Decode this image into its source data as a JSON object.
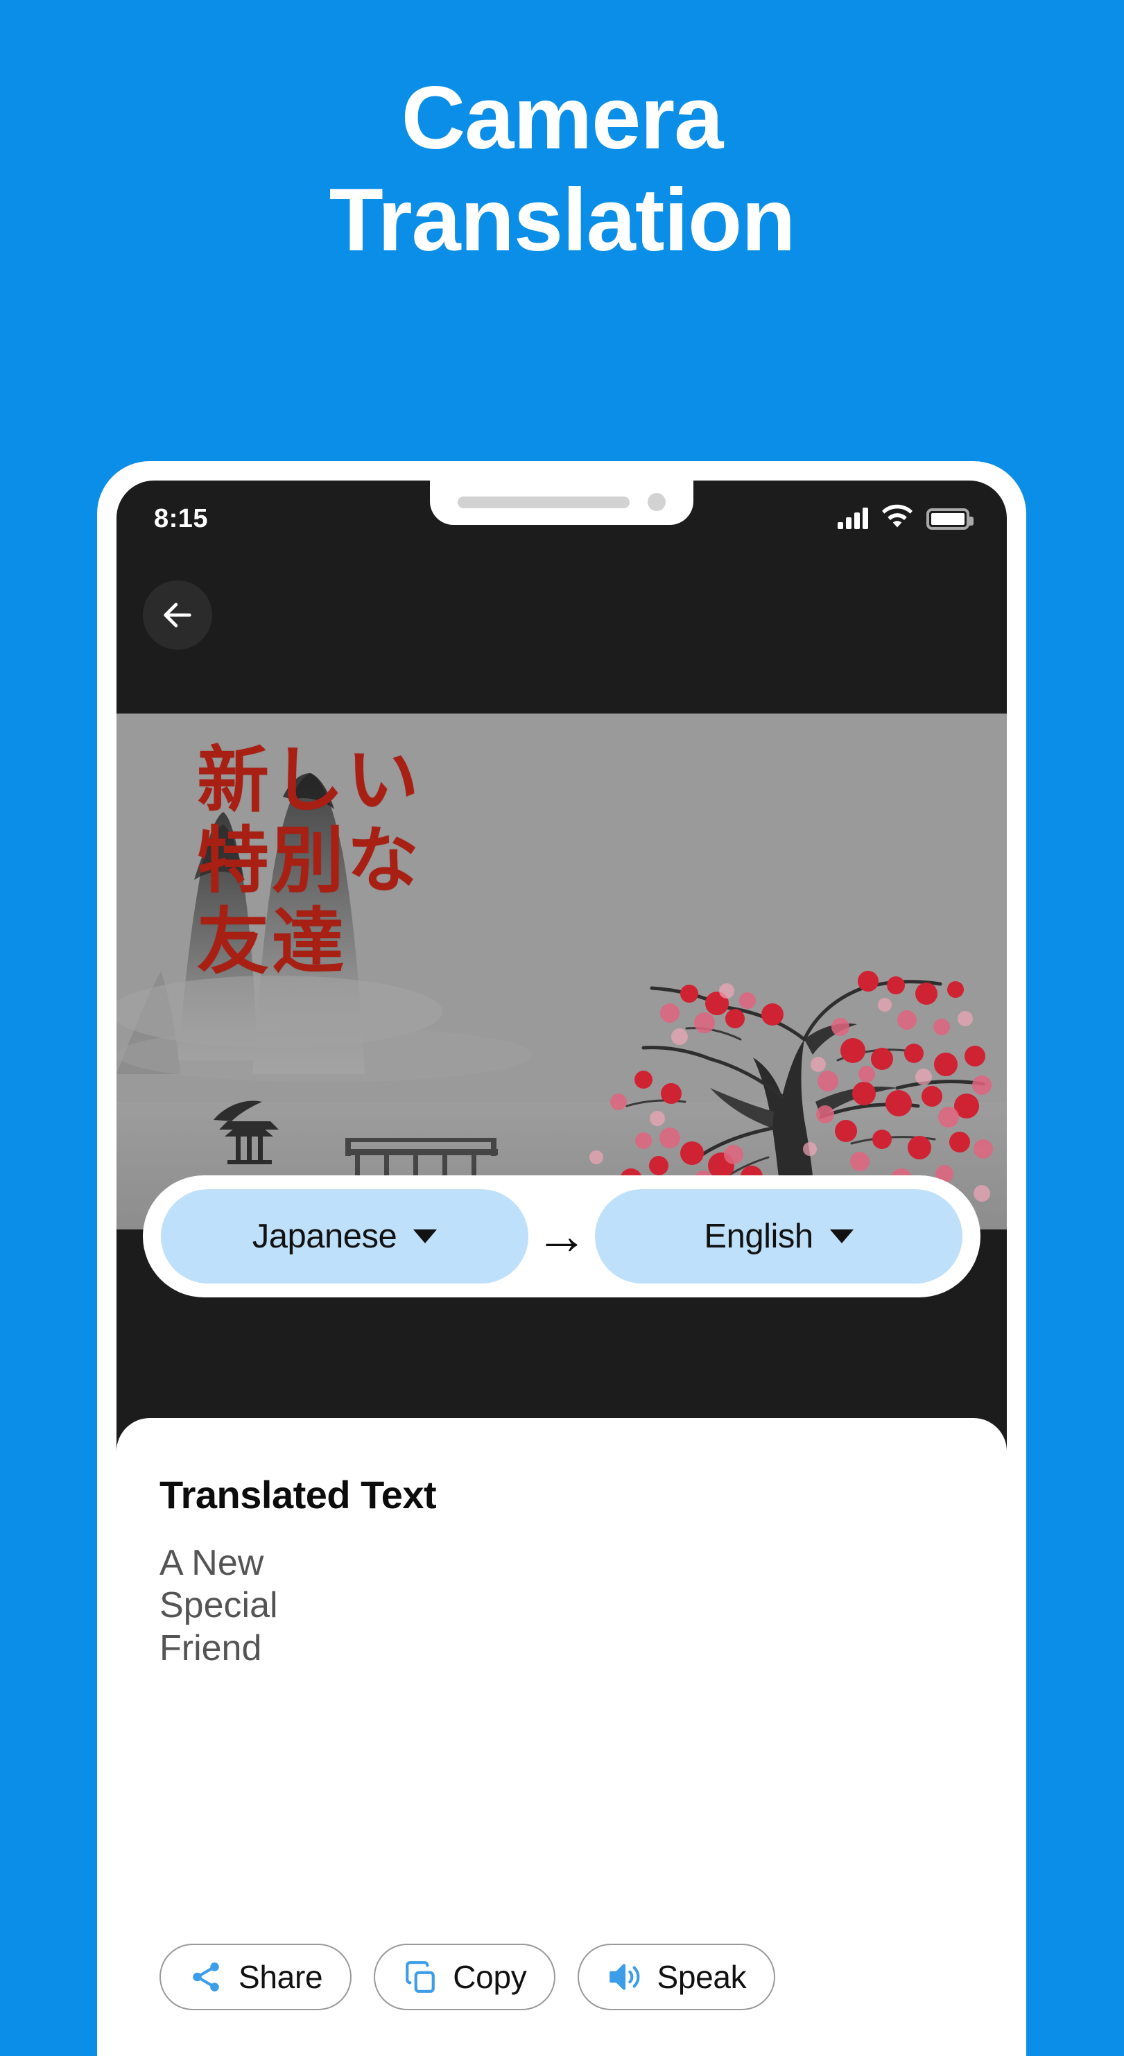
{
  "theme": {
    "background_blue": "#0b8ee8",
    "pill_blue": "#bfe0fa",
    "icon_blue": "#3c9de8",
    "overlay_red": "#a81f14"
  },
  "headline": {
    "line1": "Camera",
    "line2": "Translation"
  },
  "phone": {
    "status_bar": {
      "time": "8:15",
      "signal_icon": "cellular-signal-icon",
      "wifi_icon": "wifi-icon",
      "battery_icon": "battery-full-icon"
    },
    "nav": {
      "back_icon": "arrow-left-icon"
    },
    "camera_view": {
      "detected_text_lines": [
        "新しい",
        "特別な",
        "友達"
      ],
      "scene": "ink-wash landscape with cherry blossom tree"
    },
    "language_bar": {
      "source_language": "Japanese",
      "target_language": "English",
      "direction_icon": "arrow-right-icon",
      "dropdown_icon": "chevron-down-icon"
    },
    "result": {
      "title": "Translated Text",
      "lines": [
        "A New",
        "Special",
        "Friend"
      ]
    },
    "actions": [
      {
        "label": "Share",
        "icon": "share-icon"
      },
      {
        "label": "Copy",
        "icon": "copy-icon"
      },
      {
        "label": "Speak",
        "icon": "speaker-icon"
      }
    ]
  }
}
